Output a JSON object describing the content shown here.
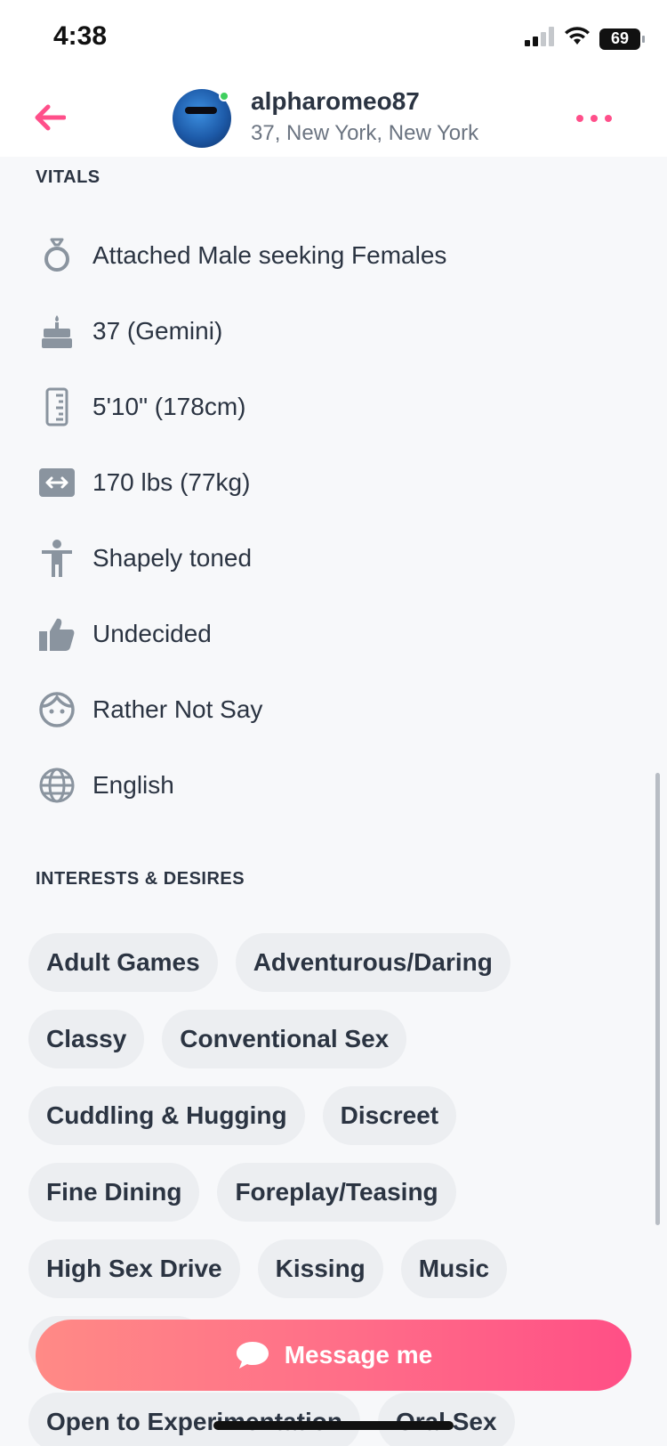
{
  "status_bar": {
    "time": "4:38",
    "battery": "69"
  },
  "header": {
    "username": "alpharomeo87",
    "location": "37, New York, New York",
    "online_color": "#3fcf5e",
    "accent_color": "#ff4f8a"
  },
  "vitals": {
    "title": "VITALS",
    "items": [
      {
        "icon": "ring-icon",
        "label": "Attached Male seeking Females"
      },
      {
        "icon": "cake-icon",
        "label": "37 (Gemini)"
      },
      {
        "icon": "ruler-icon",
        "label": "5'10\" (178cm)"
      },
      {
        "icon": "weight-icon",
        "label": "170 lbs (77kg)"
      },
      {
        "icon": "body-type-icon",
        "label": "Shapely toned"
      },
      {
        "icon": "thumbs-up-icon",
        "label": "Undecided"
      },
      {
        "icon": "face-icon",
        "label": "Rather Not Say"
      },
      {
        "icon": "globe-icon",
        "label": "English"
      }
    ]
  },
  "interests": {
    "title": "INTERESTS & DESIRES",
    "rows": [
      [
        "Adult Games",
        "Adventurous/Daring"
      ],
      [
        "Classy",
        "Conventional Sex"
      ],
      [
        "Cuddling & Hugging",
        "Discreet"
      ],
      [
        "Fine Dining",
        "Foreplay/Teasing"
      ],
      [
        "High Sex Drive",
        "Kissing",
        "Music"
      ],
      [
        "",
        ""
      ],
      [
        "Open to Experimentation",
        "Oral Sex"
      ]
    ]
  },
  "message_button": {
    "label": "Message me"
  }
}
